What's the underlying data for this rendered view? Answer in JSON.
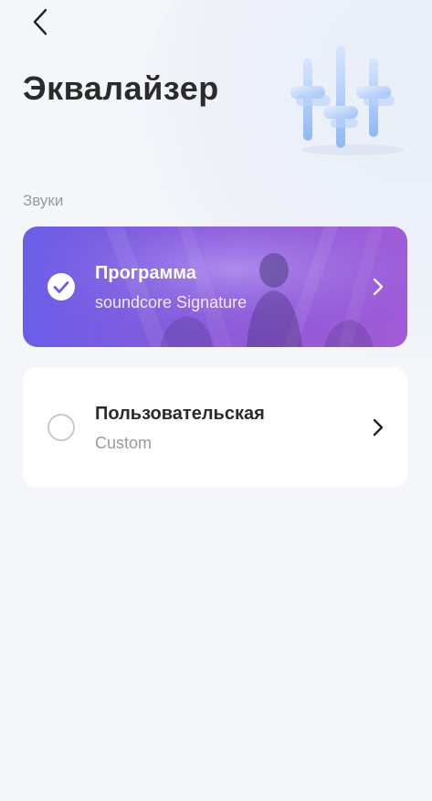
{
  "header": {
    "title": "Эквалайзер"
  },
  "section": {
    "label": "Звуки"
  },
  "presets": [
    {
      "title": "Программа",
      "subtitle": "soundcore Signature",
      "selected": true
    },
    {
      "title": "Пользовательская",
      "subtitle": "Custom",
      "selected": false
    }
  ],
  "icons": {
    "back": "back-arrow-icon",
    "selected": "check-circle-icon",
    "unselected": "radio-empty-icon",
    "chevron": "chevron-right-icon",
    "illustration": "equalizer-sliders-icon"
  },
  "colors": {
    "background": "#f5f6fa",
    "accent_start": "#6a5ee8",
    "accent_end": "#a15bd6",
    "title": "#2b2b2b",
    "muted": "#9a9a9e"
  }
}
